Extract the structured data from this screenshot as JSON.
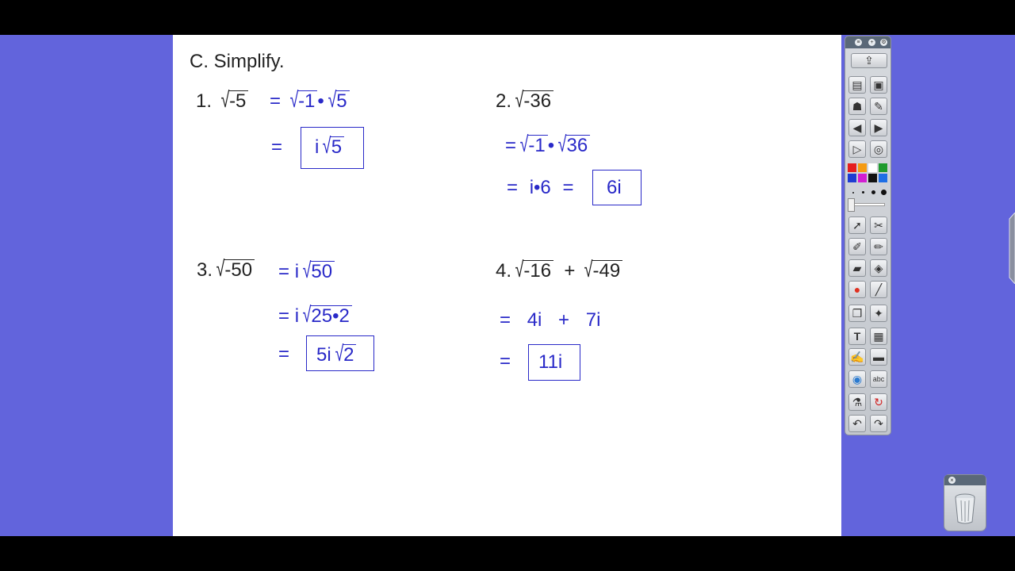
{
  "heading": "C. Simplify.",
  "problems": {
    "p1": {
      "number": "1.",
      "radicand": "-5",
      "step1": {
        "eq": "=",
        "r1": "-1",
        "dot": "•",
        "r2": "5"
      },
      "step2": {
        "eq": "=",
        "coef": "i",
        "r": "5"
      }
    },
    "p2": {
      "number": "2.",
      "radicand": "-36",
      "step1": {
        "eq": "=",
        "r1": "-1",
        "dot": "•",
        "r2": "36"
      },
      "step2": {
        "eq": "=",
        "expr": "i•6",
        "eq2": "=",
        "answer": "6i"
      }
    },
    "p3": {
      "number": "3.",
      "radicand": "-50",
      "step1": {
        "eq": "=",
        "coef": "i",
        "r": "50"
      },
      "step2": {
        "eq": "=",
        "coef": "i",
        "r": "25•2"
      },
      "step3": {
        "eq": "=",
        "coef": "5i",
        "r": "2"
      }
    },
    "p4": {
      "number": "4.",
      "r1": "-16",
      "plus": "+",
      "r2": "-49",
      "step1": {
        "eq": "=",
        "a": "4i",
        "plus": "+",
        "b": "7i"
      },
      "step2": {
        "eq": "=",
        "answer": "11i"
      }
    }
  },
  "toolbar": {
    "colors": [
      "#e61e1e",
      "#f59b12",
      "#ffffff",
      "#1e9b2e",
      "#1e3cd2",
      "#d21ed2",
      "#111111",
      "#1e6ee6"
    ],
    "icons": [
      "share-icon",
      "page-sorter-icon",
      "gallery-icon",
      "attachments-icon",
      "properties-icon",
      "prev-page-icon",
      "next-page-icon",
      "play-icon",
      "web-icon",
      "select-icon",
      "tools-icon",
      "pen-icon",
      "highlighter-icon",
      "eraser-icon",
      "fill-icon",
      "shape-icon",
      "line-icon",
      "stack-icon",
      "magic-icon",
      "text-icon",
      "table-icon",
      "recognize-icon",
      "video-icon",
      "globe-icon",
      "spell-icon",
      "flask-icon",
      "refresh-icon",
      "undo-icon",
      "redo-icon"
    ]
  },
  "trash": {
    "icon": "trash-icon"
  }
}
